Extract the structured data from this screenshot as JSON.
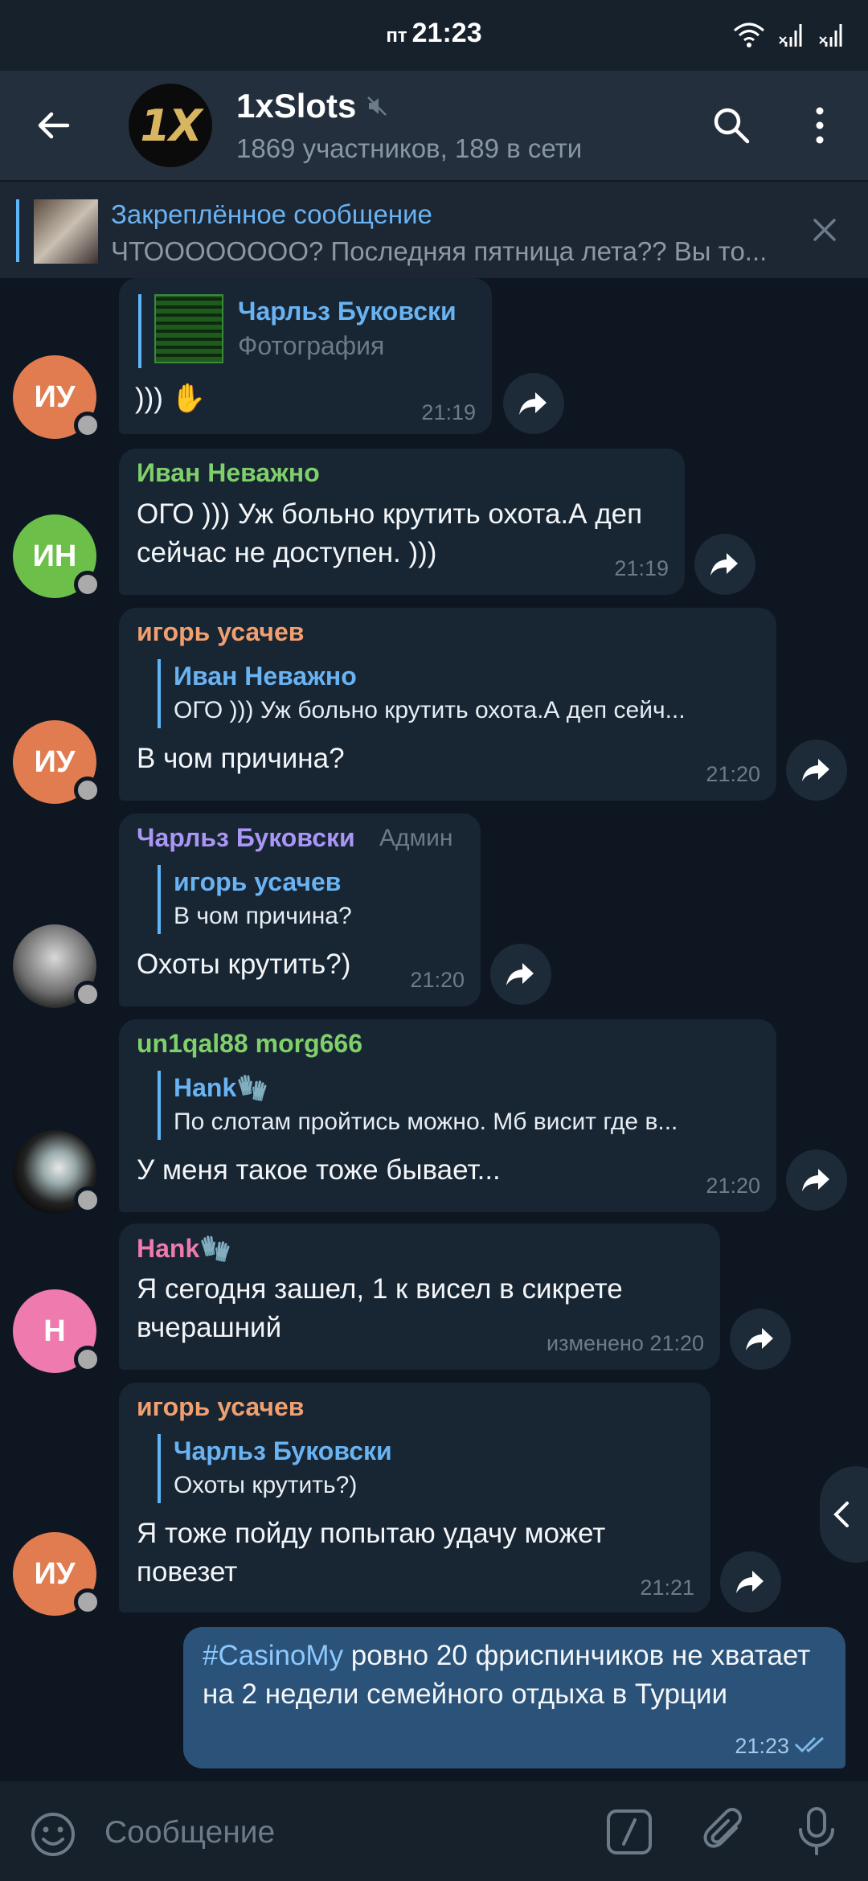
{
  "status": {
    "day": "пт",
    "time": "21:23"
  },
  "chat": {
    "title": "1xSlots",
    "subtitle": "1869 участников, 189 в сети",
    "avatar_logo": "1X"
  },
  "pinned": {
    "title": "Закреплённое сообщение",
    "text": "ЧТОООООООО?  Последняя пятница лета?? Вы то..."
  },
  "messages": [
    {
      "avatar_initials": "ИУ",
      "avatar_color": "#e17c50",
      "reply_name": "Чарльз Буковски",
      "reply_text": "Фотография",
      "text": "))) ✋",
      "time": "21:19"
    },
    {
      "avatar_initials": "ИН",
      "avatar_color": "#6cc04a",
      "sender": "Иван Неважно",
      "sender_color": "#7fd06a",
      "text": "ОГО ))) Уж больно крутить охота.А деп сейчас не доступен. )))",
      "time": "21:19"
    },
    {
      "avatar_initials": "ИУ",
      "avatar_color": "#e17c50",
      "sender": "игорь усачев",
      "sender_color": "#f0a070",
      "reply_name": "Иван Неважно",
      "reply_text": "ОГО ))) Уж больно крутить охота.А деп сейч...",
      "text": "В чом причина?",
      "time": "21:20"
    },
    {
      "sender": "Чарльз Буковски",
      "sender_color": "#a996f5",
      "badge": "Админ",
      "reply_name": "игорь усачев",
      "reply_text": "В чом причина?",
      "text": "Охоты крутить?)",
      "time": "21:20"
    },
    {
      "sender": "un1qal88 morg666",
      "sender_color": "#7fd06a",
      "reply_name": "Hank🧤",
      "reply_text": "По слотам пройтись можно. Мб висит где в...",
      "text": "У меня такое тоже бывает...",
      "time": "21:20"
    },
    {
      "avatar_initials": "Н",
      "avatar_color": "#ee7aae",
      "sender": "Hank🧤",
      "sender_color": "#ee7aae",
      "text": "Я сегодня зашел, 1 к висел в сикрете вчерашний",
      "time": "изменено 21:20"
    },
    {
      "avatar_initials": "ИУ",
      "avatar_color": "#e17c50",
      "sender": "игорь усачев",
      "sender_color": "#f0a070",
      "reply_name": "Чарльз Буковски",
      "reply_text": "Охоты крутить?)",
      "text": "Я тоже пойду попытаю удачу может повезет",
      "time": "21:21"
    }
  ],
  "outgoing": {
    "hashtag": "#CasinoMy",
    "text": " ровно 20 фриспинчиков не хватает на 2 недели семейного отдыха в Турции",
    "time": "21:23"
  },
  "input": {
    "placeholder": "Сообщение"
  },
  "colors": {
    "background": "#0e1621",
    "bubble_in": "#182533",
    "bubble_out": "#2b5278",
    "accent": "#6ab3f3"
  }
}
